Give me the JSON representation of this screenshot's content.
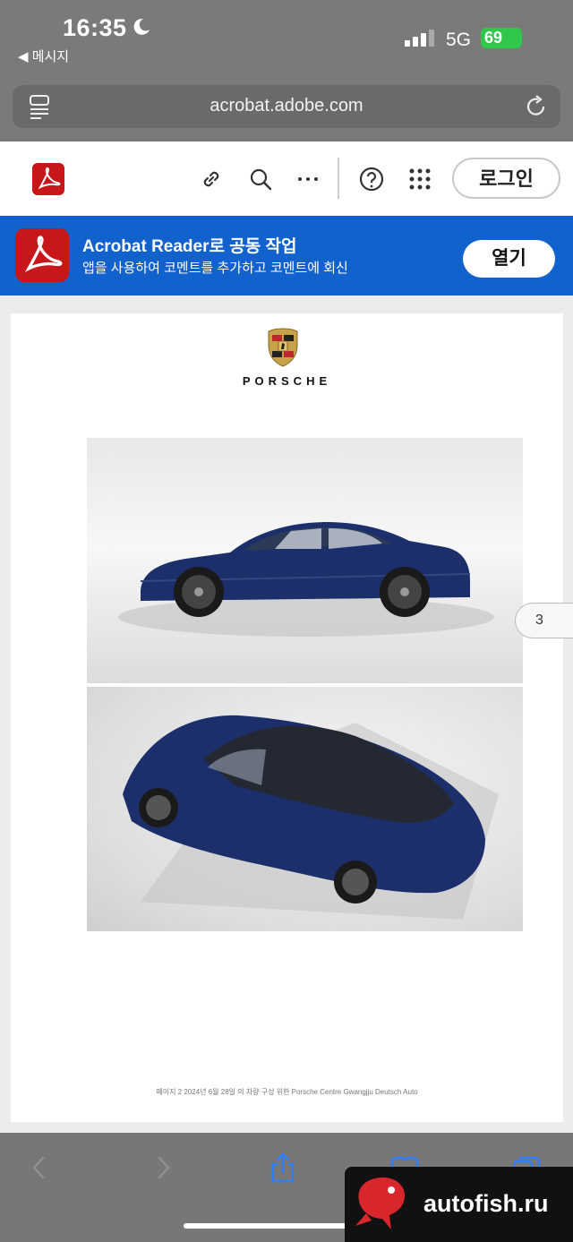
{
  "status_bar": {
    "time": "16:35",
    "back_label": "◀ 메시지",
    "network": "5G",
    "battery": "69"
  },
  "browser": {
    "url": "acrobat.adobe.com"
  },
  "header": {
    "login_label": "로그인"
  },
  "banner": {
    "title": "Acrobat Reader로 공동 작업",
    "subtitle": "앱을 사용하여 코멘트를 추가하고 코멘트에 회신",
    "open_label": "열기"
  },
  "document": {
    "brand": "PORSCHE",
    "footer_note": "페이지 2 2024년 6월 28일 의 차량 구성 위한 Porsche Centre Gwangjju Deutsch Auto",
    "page_number": "3"
  },
  "watermark": {
    "text": "autofish.ru"
  },
  "colors": {
    "acrobat_red": "#c7171b",
    "banner_blue": "#1262ce",
    "car_blue": "#1d2f6b"
  }
}
